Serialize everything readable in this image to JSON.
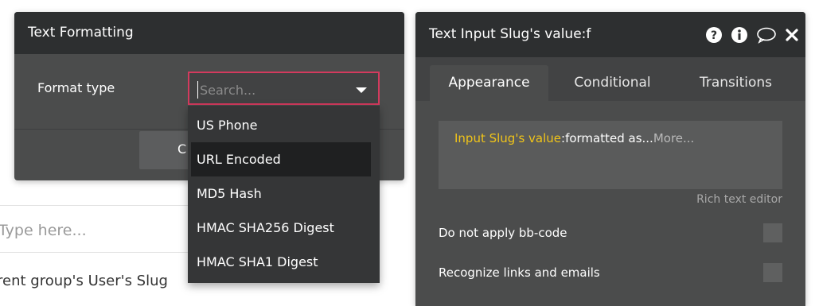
{
  "canvas": {
    "input_placeholder": "Type here...",
    "text_element": "rent group's User's Slug"
  },
  "text_formatting_panel": {
    "title": "Text Formatting",
    "format_type_label": "Format type",
    "search_placeholder": "Search...",
    "footer_button_label": "C",
    "options": [
      {
        "label": "US Phone",
        "selected": false
      },
      {
        "label": "URL Encoded",
        "selected": true
      },
      {
        "label": "MD5 Hash",
        "selected": false
      },
      {
        "label": "HMAC SHA256 Digest",
        "selected": false
      },
      {
        "label": "HMAC SHA1 Digest",
        "selected": false
      }
    ]
  },
  "property_editor": {
    "title": "Text Input Slug's value:f",
    "header_icons": [
      "help-icon",
      "info-icon",
      "comment-icon",
      "close-icon"
    ],
    "tabs": [
      {
        "label": "Appearance",
        "active": true
      },
      {
        "label": "Conditional",
        "active": false
      },
      {
        "label": "Transitions",
        "active": false
      }
    ],
    "expression": {
      "source": "Input Slug's value",
      "operator": ":formatted as...",
      "more": "More..."
    },
    "rich_text_editor_label": "Rich text editor",
    "checkboxes": [
      {
        "label": "Do not apply bb-code",
        "checked": false
      },
      {
        "label": "Recognize links and emails",
        "checked": false
      }
    ]
  },
  "colors": {
    "panel_bg": "#4b4c4c",
    "header_bg": "#2d2f30",
    "dropdown_border": "#d33a5e",
    "dynamic_highlight": "#f0c419"
  }
}
